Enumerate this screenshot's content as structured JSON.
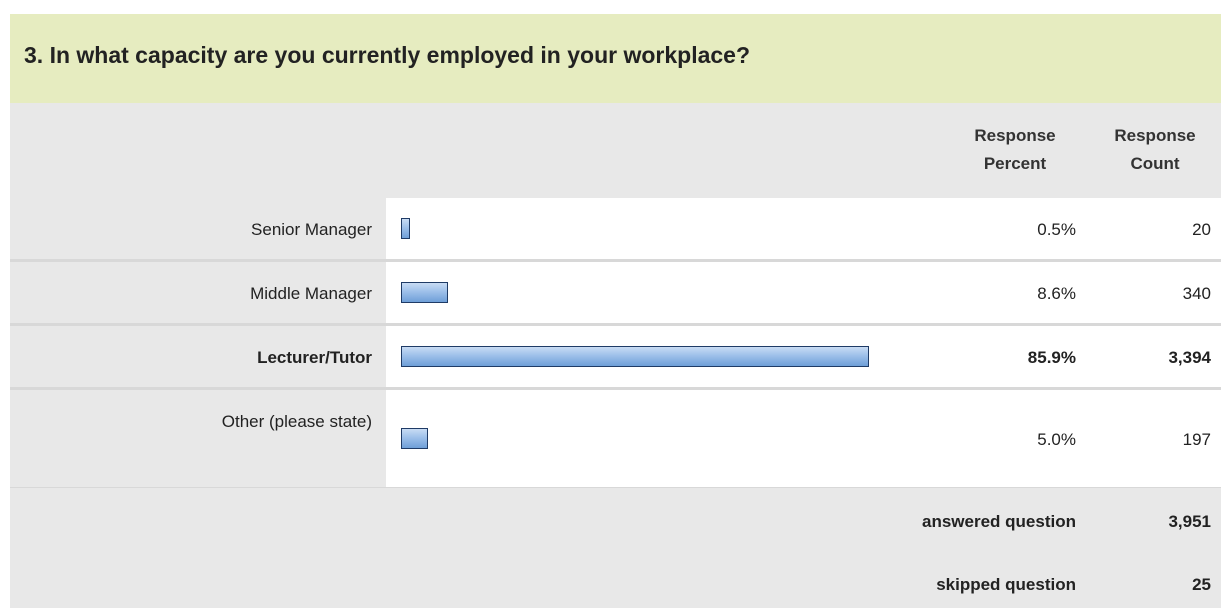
{
  "question": {
    "title": "3. In what capacity are you currently employed in your workplace?"
  },
  "header": {
    "percent_label": [
      "Response",
      "Percent"
    ],
    "count_label": [
      "Response",
      "Count"
    ]
  },
  "rows": [
    {
      "label": "Senior Manager",
      "percent": "0.5%",
      "count": "20",
      "value": 0.5,
      "bold": false
    },
    {
      "label": "Middle Manager",
      "percent": "8.6%",
      "count": "340",
      "value": 8.6,
      "bold": false
    },
    {
      "label": "Lecturer/Tutor",
      "percent": "85.9%",
      "count": "3,394",
      "value": 85.9,
      "bold": true
    },
    {
      "label": "Other (please state)",
      "percent": "5.0%",
      "count": "197",
      "value": 5.0,
      "bold": false
    }
  ],
  "footer": {
    "answered_label": "answered question",
    "answered_value": "3,951",
    "skipped_label": "skipped question",
    "skipped_value": "25"
  },
  "colors": {
    "title_bg": "#e6ecc0",
    "header_bg": "#e8e8e8",
    "bar_border": "#1f3b66",
    "bar_fill": "#9ec0ea"
  },
  "chart_data": {
    "type": "bar",
    "title": "3. In what capacity are you currently employed in your workplace?",
    "categories": [
      "Senior Manager",
      "Middle Manager",
      "Lecturer/Tutor",
      "Other (please state)"
    ],
    "series": [
      {
        "name": "Response Percent",
        "values": [
          0.5,
          8.6,
          85.9,
          5.0
        ]
      },
      {
        "name": "Response Count",
        "values": [
          20,
          340,
          3394,
          197
        ]
      }
    ],
    "xlim": [
      0,
      100
    ]
  }
}
